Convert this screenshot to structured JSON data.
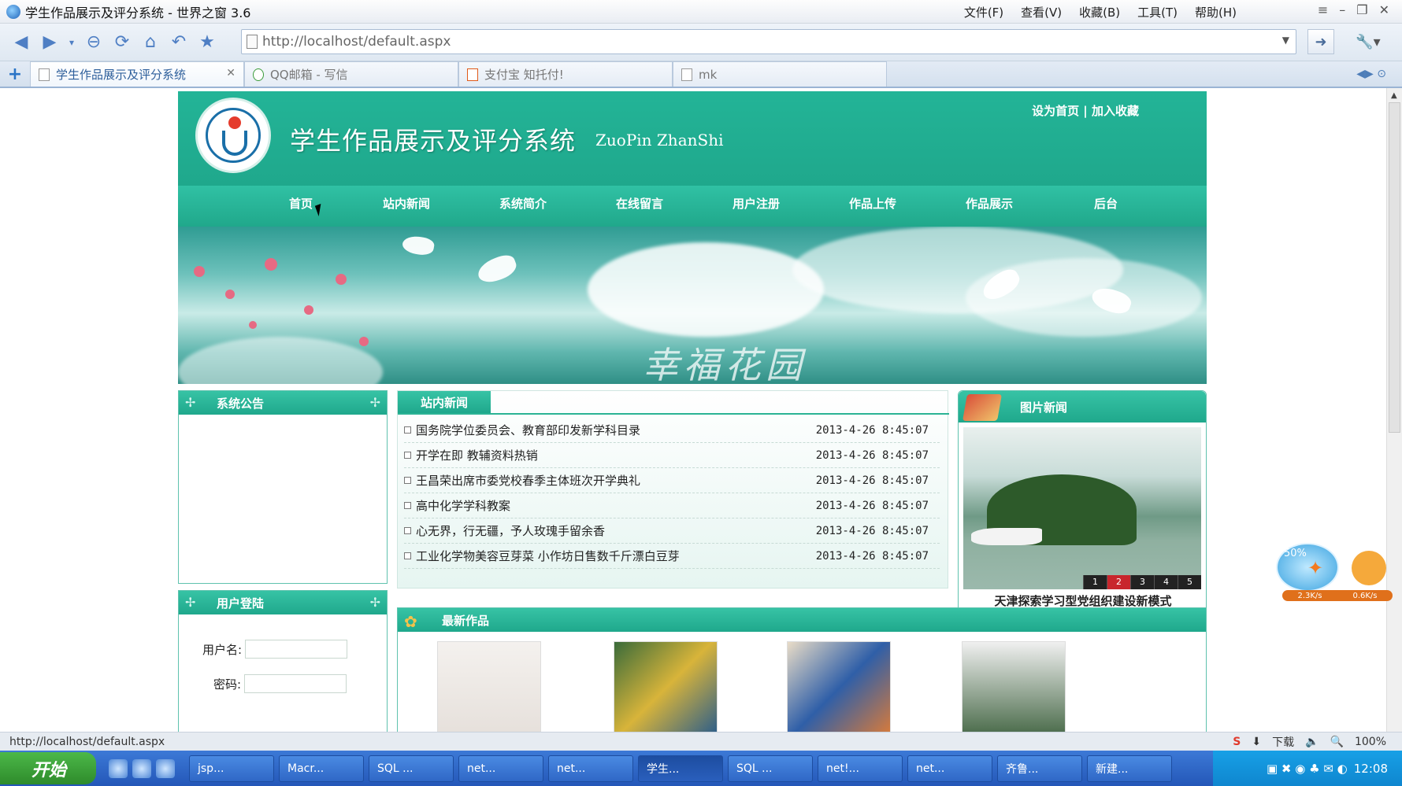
{
  "window": {
    "title": "学生作品展示及评分系统 - 世界之窗 3.6",
    "menus": [
      "文件(F)",
      "查看(V)",
      "收藏(B)",
      "工具(T)",
      "帮助(H)"
    ]
  },
  "address": {
    "url": "http://localhost/default.aspx"
  },
  "tabs": [
    {
      "label": "学生作品展示及评分系统"
    },
    {
      "label": "QQ邮箱 - 写信"
    },
    {
      "label": "支付宝 知托付!"
    },
    {
      "label": "mk"
    }
  ],
  "site": {
    "title": "学生作品展示及评分系统",
    "subtitle": "ZuoPin ZhanShi",
    "top_links": "设为首页 | 加入收藏",
    "nav": [
      "首页",
      "站内新闻",
      "系统简介",
      "在线留言",
      "用户注册",
      "作品上传",
      "作品展示",
      "后台"
    ],
    "banner_text": "幸福花园",
    "notice_title": "系统公告",
    "login": {
      "title": "用户登陆",
      "username_label": "用户名:",
      "password_label": "密码:"
    },
    "news_title": "站内新闻",
    "news": [
      {
        "title": "国务院学位委员会、教育部印发新学科目录",
        "date": "2013-4-26 8:45:07"
      },
      {
        "title": "开学在即 教辅资料热销",
        "date": "2013-4-26 8:45:07"
      },
      {
        "title": "王昌荣出席市委党校春季主体班次开学典礼",
        "date": "2013-4-26 8:45:07"
      },
      {
        "title": "高中化学学科教案",
        "date": "2013-4-26 8:45:07"
      },
      {
        "title": "心无界，行无疆，予人玫瑰手留余香",
        "date": "2013-4-26 8:45:07"
      },
      {
        "title": "工业化学物美容豆芽菜 小作坊日售数千斤漂白豆芽",
        "date": "2013-4-26 8:45:07"
      }
    ],
    "pic_news": {
      "title": "图片新闻",
      "caption": "天津探索学习型党组织建设新模式",
      "pages": [
        "1",
        "2",
        "3",
        "4",
        "5"
      ],
      "active_page": "2"
    },
    "latest_title": "最新作品"
  },
  "status": {
    "url": "http://localhost/default.aspx",
    "download": "下载",
    "zoom": "100%"
  },
  "taskbar": {
    "start": "开始",
    "tasks": [
      "jsp...",
      "Macr...",
      "SQL ...",
      "net...",
      "net...",
      "学生...",
      "SQL ...",
      "net!...",
      "net...",
      "齐鲁...",
      "新建..."
    ],
    "clock": "12:08"
  },
  "widget": {
    "percent": "50%",
    "up": "2.3K/s",
    "down": "0.6K/s"
  }
}
